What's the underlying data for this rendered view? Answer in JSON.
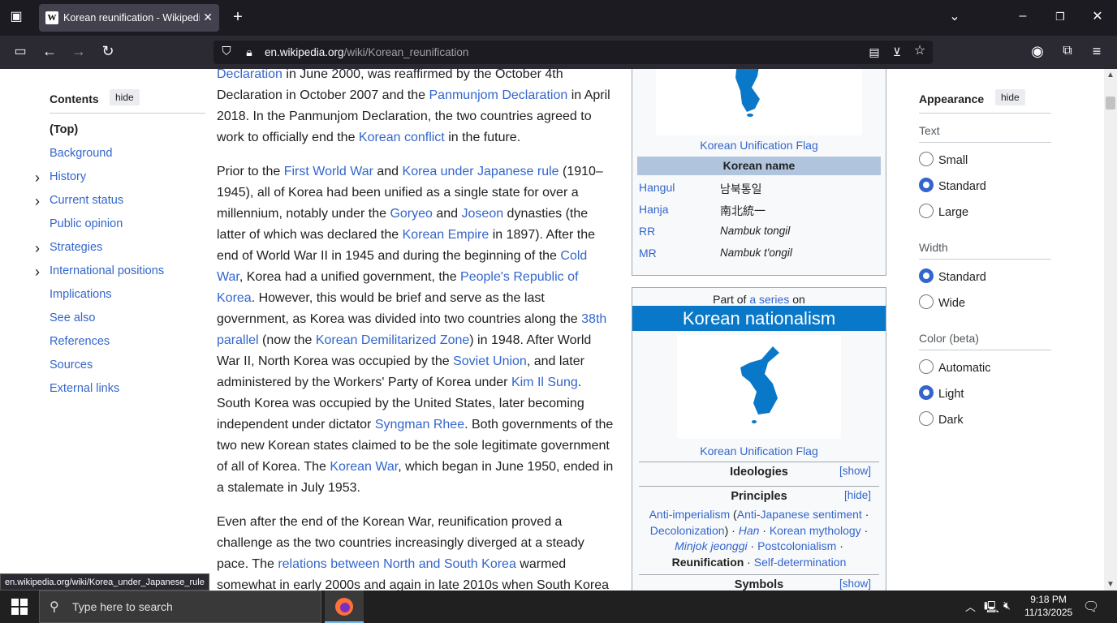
{
  "browser": {
    "tab_title": "Korean reunification - Wikipedia",
    "url_host": "en.wikipedia.org",
    "url_path": "/wiki/Korean_reunification",
    "status_url": "en.wikipedia.org/wiki/Korea_under_Japanese_rule"
  },
  "toc": {
    "title": "Contents",
    "hide": "hide",
    "items": [
      {
        "label": "(Top)",
        "expandable": false
      },
      {
        "label": "Background",
        "expandable": false
      },
      {
        "label": "History",
        "expandable": true
      },
      {
        "label": "Current status",
        "expandable": true
      },
      {
        "label": "Public opinion",
        "expandable": false
      },
      {
        "label": "Strategies",
        "expandable": true
      },
      {
        "label": "International positions",
        "expandable": true
      },
      {
        "label": "Implications",
        "expandable": false
      },
      {
        "label": "See also",
        "expandable": false
      },
      {
        "label": "References",
        "expandable": false
      },
      {
        "label": "Sources",
        "expandable": false
      },
      {
        "label": "External links",
        "expandable": false
      }
    ]
  },
  "article": {
    "p1": [
      [
        [
          "l",
          "Declaration"
        ],
        [
          "t",
          " in June 2000, was reaffirmed by the October 4th"
        ]
      ],
      [
        [
          "t",
          "Declaration in October 2007 and the "
        ],
        [
          "l",
          "Panmunjom Declaration"
        ],
        [
          "t",
          " in April"
        ]
      ],
      [
        [
          "t",
          "2018. In the Panmunjom Declaration, the two countries agreed to"
        ]
      ],
      [
        [
          "t",
          "work to officially end the "
        ],
        [
          "l",
          "Korean conflict"
        ],
        [
          "t",
          " in the future."
        ]
      ]
    ],
    "p2": [
      [
        [
          "t",
          "Prior to the "
        ],
        [
          "l",
          "First World War"
        ],
        [
          "t",
          " and "
        ],
        [
          "l",
          "Korea under Japanese rule"
        ],
        [
          "t",
          " (1910–"
        ]
      ],
      [
        [
          "t",
          "1945), all of Korea had been unified as a single state for over a"
        ]
      ],
      [
        [
          "t",
          "millennium, notably under the "
        ],
        [
          "l",
          "Goryeo"
        ],
        [
          "t",
          " and "
        ],
        [
          "l",
          "Joseon"
        ],
        [
          "t",
          " dynasties (the"
        ]
      ],
      [
        [
          "t",
          "latter of which was declared the "
        ],
        [
          "l",
          "Korean Empire"
        ],
        [
          "t",
          " in 1897). After the"
        ]
      ],
      [
        [
          "t",
          "end of World War II in 1945 and during the beginning of the "
        ],
        [
          "l",
          "Cold"
        ]
      ],
      [
        [
          "l",
          "War"
        ],
        [
          "t",
          ", Korea had a unified government, the "
        ],
        [
          "l",
          "People's Republic of"
        ]
      ],
      [
        [
          "l",
          "Korea"
        ],
        [
          "t",
          ". However, this would be brief and serve as the last"
        ]
      ],
      [
        [
          "t",
          "government, as Korea was divided into two countries along the "
        ],
        [
          "l",
          "38th"
        ]
      ],
      [
        [
          "l",
          "parallel"
        ],
        [
          "t",
          " (now the "
        ],
        [
          "l",
          "Korean Demilitarized Zone"
        ],
        [
          "t",
          ") in 1948. After World"
        ]
      ],
      [
        [
          "t",
          "War II, North Korea was occupied by the "
        ],
        [
          "l",
          "Soviet Union"
        ],
        [
          "t",
          ", and later"
        ]
      ],
      [
        [
          "t",
          "administered by the Workers' Party of Korea under "
        ],
        [
          "l",
          "Kim Il Sung"
        ],
        [
          "t",
          "."
        ]
      ],
      [
        [
          "t",
          "South Korea was occupied by the United States, later becoming"
        ]
      ],
      [
        [
          "t",
          "independent under dictator "
        ],
        [
          "l",
          "Syngman Rhee"
        ],
        [
          "t",
          ". Both governments of the"
        ]
      ],
      [
        [
          "t",
          "two new Korean states claimed to be the sole legitimate government"
        ]
      ],
      [
        [
          "t",
          "of all of Korea. The "
        ],
        [
          "l",
          "Korean War"
        ],
        [
          "t",
          ", which began in June 1950, ended in"
        ]
      ],
      [
        [
          "t",
          "a stalemate in July 1953."
        ]
      ]
    ],
    "p3": [
      [
        [
          "t",
          "Even after the end of the Korean War, reunification proved a"
        ]
      ],
      [
        [
          "t",
          "challenge as the two countries increasingly diverged at a steady"
        ]
      ],
      [
        [
          "t",
          "pace. The "
        ],
        [
          "l",
          "relations between North and South Korea"
        ],
        [
          "t",
          " warmed"
        ]
      ],
      [
        [
          "t",
          "somewhat in early 2000s and again in late 2010s when South Korea"
        ]
      ]
    ]
  },
  "infobox1": {
    "caption": "Korean Unification Flag",
    "name_header": "Korean name",
    "rows": [
      {
        "label": "Hangul",
        "value": "남북통일",
        "italic": false
      },
      {
        "label": "Hanja",
        "value": "南北統一",
        "italic": false
      },
      {
        "label": "RR",
        "value": "Nambuk tongil",
        "italic": true
      },
      {
        "label": "MR",
        "value": "Nambuk t'ongil",
        "italic": true
      }
    ]
  },
  "infobox2": {
    "part_of_pre": "Part of ",
    "part_of_link": "a series",
    "part_of_post": " on",
    "title": "Korean nationalism",
    "caption": "Korean Unification Flag",
    "ideologies": "Ideologies",
    "show": "[show]",
    "principles": "Principles",
    "hide": "[hide]",
    "principles_l1a": "Anti-imperialism",
    "principles_l1b": "Anti-Japanese sentiment",
    "principles_l2a": "Decolonization",
    "principles_l2b": "Han",
    "principles_l2c": "Korean mythology",
    "principles_l3a": "Minjok jeonggi",
    "principles_l3b": "Postcolonialism",
    "principles_l4a": "Reunification",
    "principles_l4b": "Self-determination",
    "symbols": "Symbols"
  },
  "appearance": {
    "title": "Appearance",
    "hide": "hide",
    "text_label": "Text",
    "text_options": [
      {
        "label": "Small",
        "on": false
      },
      {
        "label": "Standard",
        "on": true
      },
      {
        "label": "Large",
        "on": false
      }
    ],
    "width_label": "Width",
    "width_options": [
      {
        "label": "Standard",
        "on": true
      },
      {
        "label": "Wide",
        "on": false
      }
    ],
    "color_label": "Color (beta)",
    "color_options": [
      {
        "label": "Automatic",
        "on": false
      },
      {
        "label": "Light",
        "on": true
      },
      {
        "label": "Dark",
        "on": false
      }
    ]
  },
  "taskbar": {
    "search_placeholder": "Type here to search",
    "time": "9:18 PM",
    "date": "11/13/2025"
  },
  "colors": {
    "link": "#3366cc",
    "flag_blue": "#0a78c8",
    "name_header_bg": "#b0c4de"
  }
}
